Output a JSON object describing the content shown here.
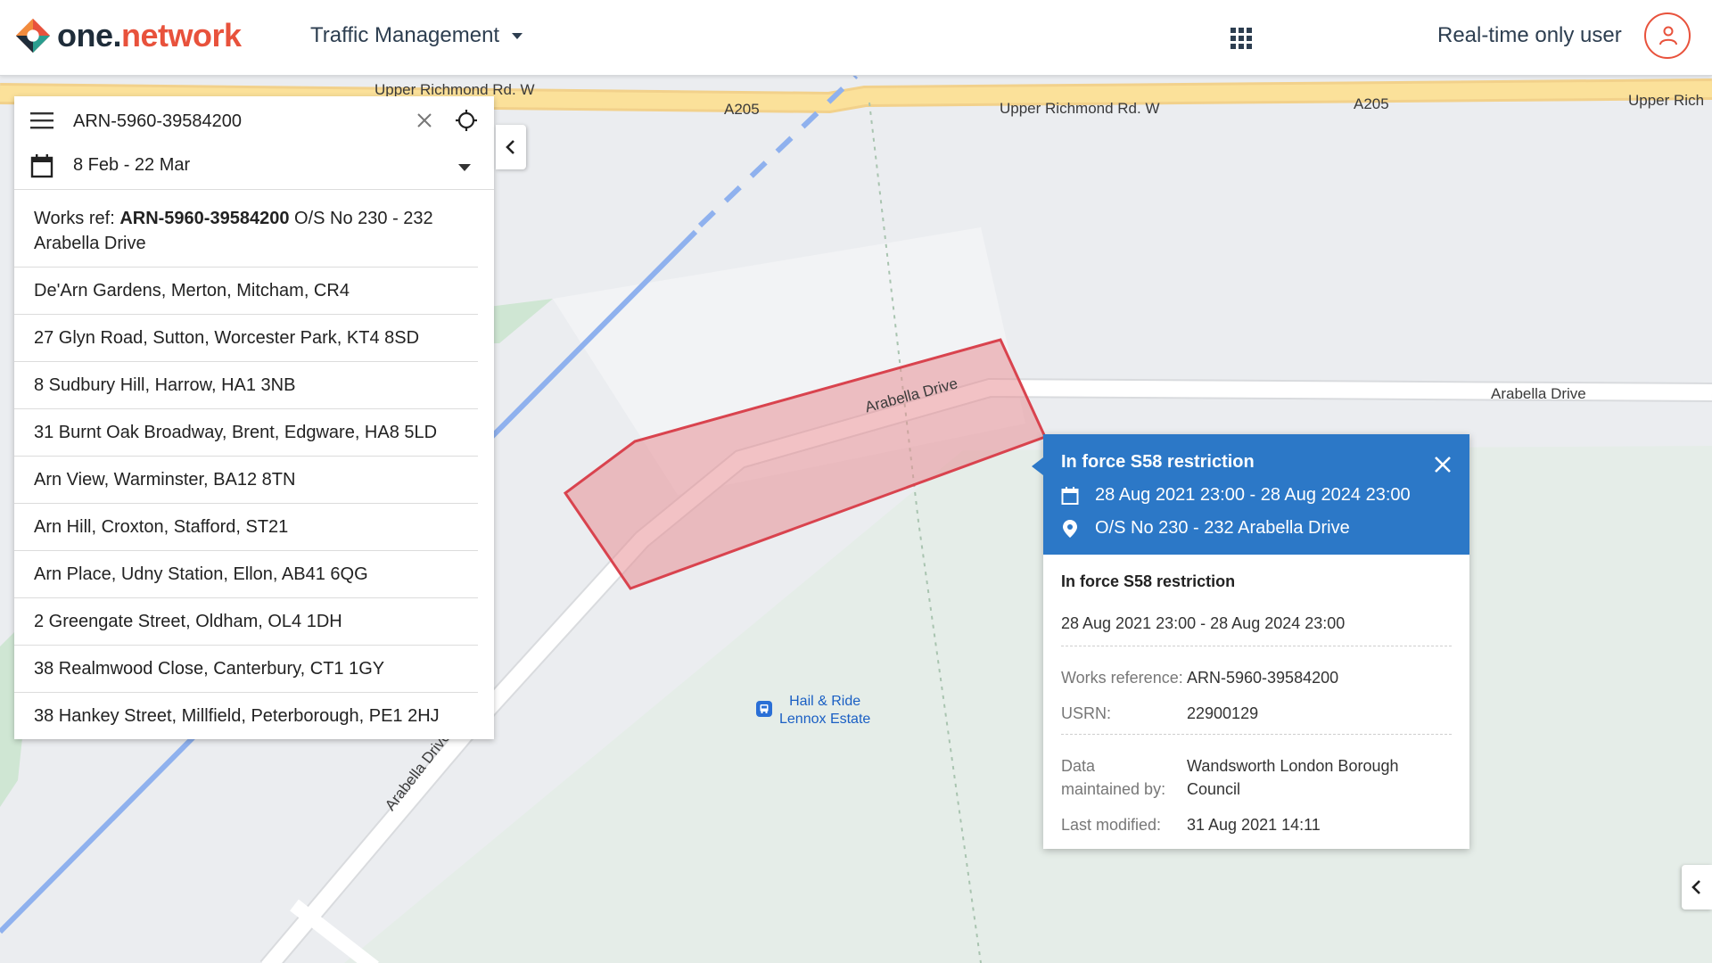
{
  "header": {
    "logo_parts": {
      "one": "one",
      "dot": ".",
      "network": "network"
    },
    "app_switch_label": "Traffic Management",
    "user_label": "Real-time only user",
    "colors": {
      "brand_orange": "#e8523c",
      "brand_dark": "#1f2d3a",
      "accent_blue": "#2c78c7"
    }
  },
  "search": {
    "query": "ARN-5960-39584200",
    "date_range": "8 Feb - 22 Mar",
    "first_result": {
      "prefix": "Works ref: ",
      "ref": "ARN-5960-39584200",
      "suffix": " O/S No 230 - 232 Arabella Drive"
    },
    "results": [
      "De'Arn Gardens, Merton, Mitcham, CR4",
      "27 Glyn Road, Sutton, Worcester Park, KT4 8SD",
      "8 Sudbury Hill, Harrow, HA1 3NB",
      "31 Burnt Oak Broadway, Brent, Edgware, HA8 5LD",
      "Arn View, Warminster, BA12 8TN",
      "Arn Hill, Croxton, Stafford, ST21",
      "Arn Place, Udny Station, Ellon, AB41 6QG",
      "2 Greengate Street, Oldham, OL4 1DH",
      "38 Realmwood Close, Canterbury, CT1 1GY",
      "38 Hankey Street, Millfield, Peterborough, PE1 2HJ"
    ]
  },
  "map": {
    "road_labels": {
      "upper_richmond_partial": "Upper Richmond Rd. W",
      "a205_a": "A205",
      "upper_richmond": "Upper Richmond Rd. W",
      "a205_b": "A205",
      "upper_rich": "Upper Rich",
      "arabella_curve": "Arabella Drive",
      "arabella_right": "Arabella Drive",
      "arabella_lower": "Arabella Drive"
    },
    "poi": {
      "line1": "Hail & Ride",
      "line2": "Lennox Estate",
      "icon": "bus-stop-icon"
    }
  },
  "popup": {
    "title": "In force S58 restriction",
    "dates": "28 Aug 2021 23:00 - 28 Aug 2024 23:00",
    "location": "O/S No 230 - 232 Arabella Drive",
    "body": {
      "title": "In force S58 restriction",
      "dates": "28 Aug 2021 23:00 - 28 Aug 2024 23:00",
      "works_reference_label": "Works reference:",
      "works_reference_value": "ARN-5960-39584200",
      "usrn_label": "USRN:",
      "usrn_value": "22900129",
      "maintained_label": "Data maintained by:",
      "maintained_value": "Wandsworth London Borough Council",
      "modified_label": "Last modified:",
      "modified_value": "31 Aug 2021 14:11"
    }
  }
}
